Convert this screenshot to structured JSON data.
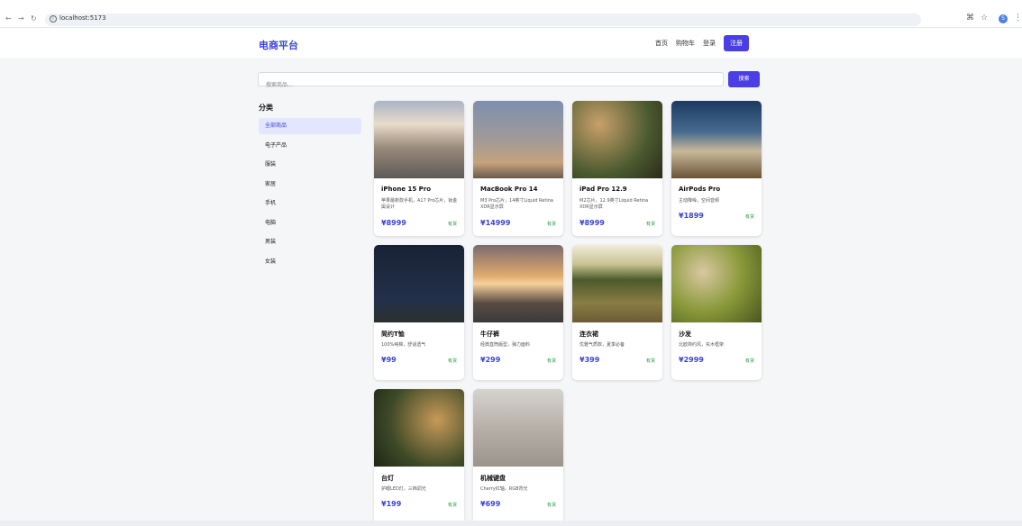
{
  "browser": {
    "url": "localhost:5173",
    "profile_initial": "S"
  },
  "header": {
    "brand": "电商平台",
    "nav": [
      "首页",
      "购物车",
      "登录"
    ],
    "register": "注册"
  },
  "search": {
    "placeholder": "搜索商品...",
    "button": "搜索"
  },
  "sidebar": {
    "title": "分类",
    "items": [
      {
        "label": "全部商品",
        "active": true
      },
      {
        "label": "电子产品"
      },
      {
        "label": "服装"
      },
      {
        "label": "家居"
      },
      {
        "label": "手机"
      },
      {
        "label": "电脑"
      },
      {
        "label": "男装"
      },
      {
        "label": "女装"
      }
    ]
  },
  "products": [
    {
      "name": "iPhone 15 Pro",
      "desc": "苹果最新款手机，A17 Pro芯片，钛金属设计",
      "price": "¥8999",
      "stock": "有货"
    },
    {
      "name": "MacBook Pro 14",
      "desc": "M3 Pro芯片，14英寸Liquid Retina XDR显示屏",
      "price": "¥14999",
      "stock": "有货"
    },
    {
      "name": "iPad Pro 12.9",
      "desc": "M2芯片，12.9英寸Liquid Retina XDR显示屏",
      "price": "¥8999",
      "stock": "有货"
    },
    {
      "name": "AirPods Pro",
      "desc": "主动降噪，空间音频",
      "price": "¥1899",
      "stock": "有货"
    },
    {
      "name": "简约T恤",
      "desc": "100%纯棉，舒适透气",
      "price": "¥99",
      "stock": "有货"
    },
    {
      "name": "牛仔裤",
      "desc": "经典直筒版型，弹力面料",
      "price": "¥299",
      "stock": "有货"
    },
    {
      "name": "连衣裙",
      "desc": "优雅气质款，夏季必备",
      "price": "¥399",
      "stock": "有货"
    },
    {
      "name": "沙发",
      "desc": "北欧简约风，实木框架",
      "price": "¥2999",
      "stock": "有货"
    },
    {
      "name": "台灯",
      "desc": "护眼LED灯，三档调光",
      "price": "¥199",
      "stock": "有货"
    },
    {
      "name": "机械键盘",
      "desc": "Cherry红轴，RGB背光",
      "price": "¥699",
      "stock": "有货"
    }
  ],
  "colors": {
    "accent": "#4a3fe6",
    "brand": "#3b44d6",
    "in_stock": "#1a9a3a"
  }
}
